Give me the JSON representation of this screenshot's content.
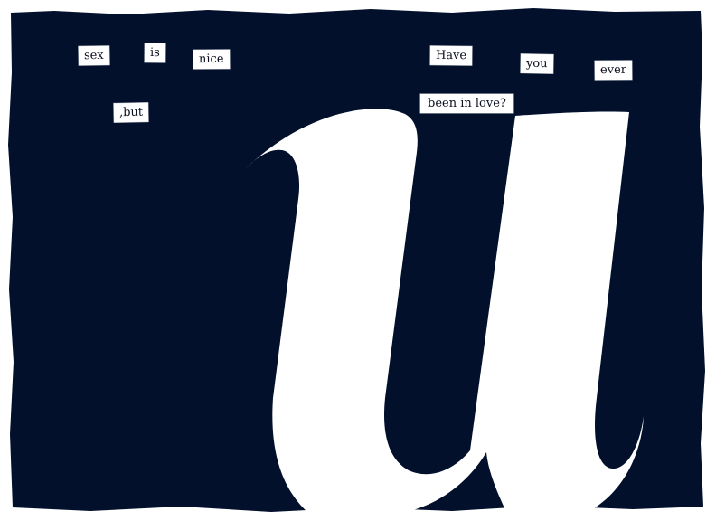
{
  "colors": {
    "background": "#ffffff",
    "panel": "#02102c",
    "letter": "#ffffff",
    "word_text": "#0b0f1e",
    "word_paper": "#ffffff"
  },
  "words": {
    "sex": "sex",
    "is": "is",
    "nice": "nice",
    "but": ",but",
    "have": "Have",
    "you": "you",
    "ever": "ever",
    "been_in_love": "been in love?"
  },
  "graphic": {
    "large_glyph_icon": "lowercase-u-letterform"
  }
}
